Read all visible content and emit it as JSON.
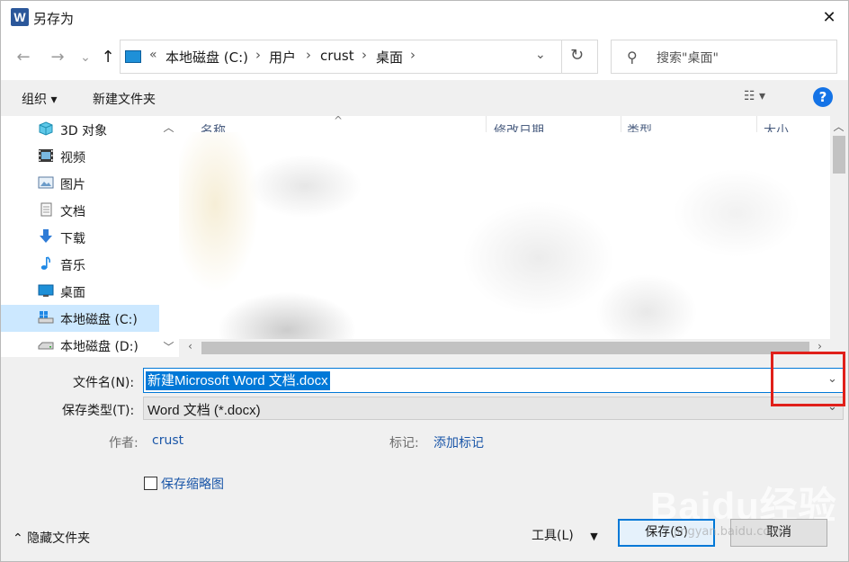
{
  "window": {
    "title": "另存为",
    "app_icon_letter": "W",
    "close": "✕"
  },
  "nav": {
    "back": "←",
    "forward": "→",
    "recent": "⌄",
    "up": "↑"
  },
  "address": {
    "overflow": "«",
    "crumbs": [
      "本地磁盘 (C:)",
      "用户",
      "crust",
      "桌面"
    ],
    "sep": "›",
    "dropdown": "⌄",
    "refresh": "↻"
  },
  "search": {
    "placeholder": "搜索\"桌面\""
  },
  "toolbar": {
    "organize": "组织 ▾",
    "new_folder": "新建文件夹",
    "view": "☷ ▾",
    "help": "?"
  },
  "nav_pane": {
    "items": [
      {
        "label": "3D 对象",
        "icon": "cube-icon"
      },
      {
        "label": "视频",
        "icon": "video-icon"
      },
      {
        "label": "图片",
        "icon": "pictures-icon"
      },
      {
        "label": "文档",
        "icon": "document-icon"
      },
      {
        "label": "下载",
        "icon": "download-icon"
      },
      {
        "label": "音乐",
        "icon": "music-icon"
      },
      {
        "label": "桌面",
        "icon": "desktop-icon"
      },
      {
        "label": "本地磁盘 (C:)",
        "icon": "drive-c-icon",
        "selected": true
      },
      {
        "label": "本地磁盘 (D:)",
        "icon": "drive-icon"
      }
    ]
  },
  "columns": {
    "name": "名称",
    "modified": "修改日期",
    "type": "类型",
    "size": "大小"
  },
  "form": {
    "filename_label": "文件名(N):",
    "filename_value": "新建Microsoft Word 文档.docx",
    "filetype_label": "保存类型(T):",
    "filetype_value": "Word 文档 (*.docx)",
    "author_label": "作者:",
    "author_value": "crust",
    "tags_label": "标记:",
    "tags_value": "添加标记",
    "thumbnail_label": "保存缩略图"
  },
  "footer": {
    "hide_folders": "⌃ 隐藏文件夹",
    "tools": "工具(L)",
    "tools_caret": "▼",
    "save": "保存(S)",
    "cancel": "取消"
  },
  "watermark": {
    "logo": "Baidu经验",
    "url": "jingyan.baidu.com"
  },
  "colors": {
    "accent": "#0078d7",
    "highlight": "#e0201a",
    "selected_bg": "#cce8ff"
  }
}
